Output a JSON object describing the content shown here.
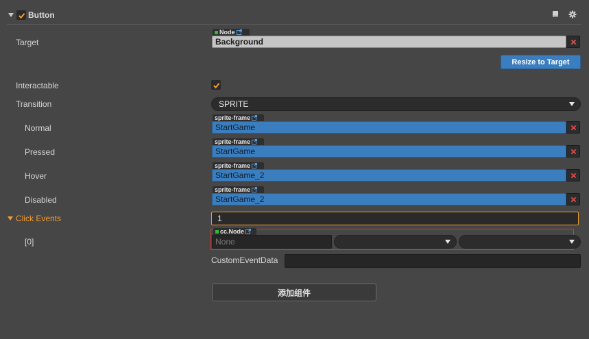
{
  "component": {
    "title": "Button",
    "enabled": true,
    "icons": [
      "book-icon",
      "gear-icon"
    ]
  },
  "target": {
    "label": "Target",
    "type_tag": "Node",
    "value": "Background",
    "resize_button": "Resize to Target"
  },
  "interactable": {
    "label": "Interactable",
    "checked": true
  },
  "transition": {
    "label": "Transition",
    "value": "SPRITE"
  },
  "states": [
    {
      "label": "Normal",
      "type_tag": "sprite-frame",
      "value": "StartGame"
    },
    {
      "label": "Pressed",
      "type_tag": "sprite-frame",
      "value": "StartGame"
    },
    {
      "label": "Hover",
      "type_tag": "sprite-frame",
      "value": "StartGame_2"
    },
    {
      "label": "Disabled",
      "type_tag": "sprite-frame",
      "value": "StartGame_2"
    }
  ],
  "click_events": {
    "label": "Click Events",
    "count": "1",
    "items": [
      {
        "label": "[0]",
        "type_tag": "cc.Node",
        "node_value": "None",
        "component_value": "",
        "handler_value": "",
        "custom_label": "CustomEventData",
        "custom_value": ""
      }
    ]
  },
  "add_component_button": "添加组件",
  "colors": {
    "panel_bg": "#464646",
    "accent_orange": "#f39c2f",
    "accent_blue": "#3b7ebf",
    "error_red": "#d23a3a"
  }
}
